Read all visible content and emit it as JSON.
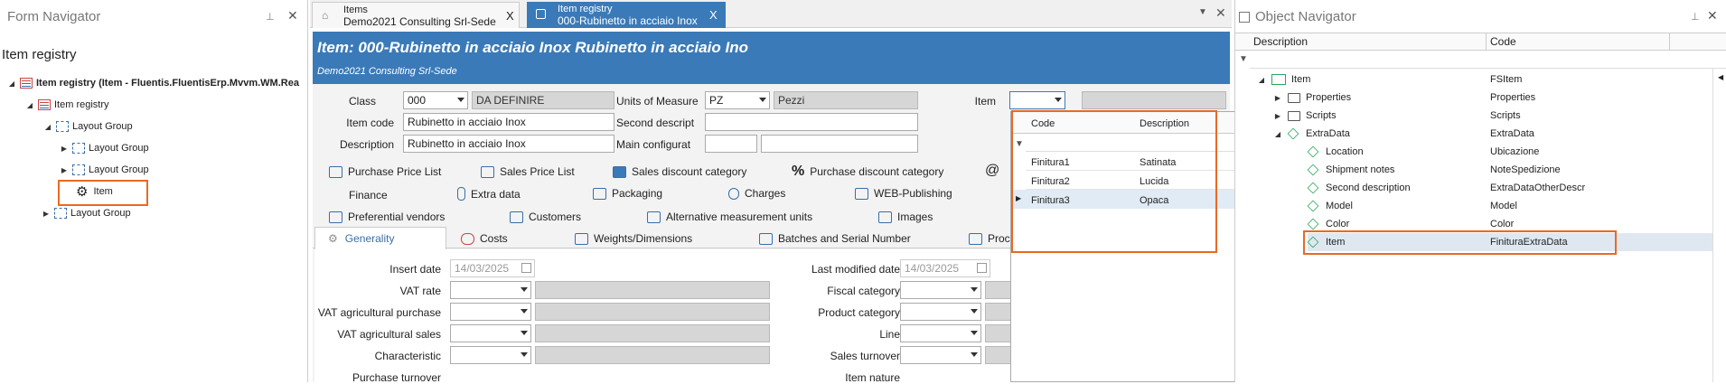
{
  "form_navigator": {
    "title": "Form Navigator",
    "subtitle": "Item registry",
    "tree": [
      {
        "label": "Item registry (Item - Fluentis.FluentisErp.Mvvm.WM.Rea"
      },
      {
        "label": "Item registry"
      },
      {
        "label": "Layout Group"
      },
      {
        "label": "Layout Group"
      },
      {
        "label": "Layout Group"
      },
      {
        "label": "Item"
      },
      {
        "label": "Layout Group"
      }
    ]
  },
  "tabs": [
    {
      "line1": "Items",
      "line2": "Demo2021 Consulting Srl-Sede"
    },
    {
      "line1": "Item registry",
      "line2": "000-Rubinetto in acciaio Inox"
    }
  ],
  "header": {
    "title": "Item: 000-Rubinetto in acciaio Inox Rubinetto in acciaio Ino",
    "subtitle": "Demo2021 Consulting Srl-Sede"
  },
  "form": {
    "class_label": "Class",
    "class_value": "000",
    "class_desc": "DA DEFINIRE",
    "uom_label": "Units of Measure",
    "uom_value": "PZ",
    "uom_desc": "Pezzi",
    "item_label": "Item",
    "item_code_label": "Item code",
    "item_code_value": "Rubinetto in acciaio Inox",
    "second_desc_label": "Second descript",
    "description_label": "Description",
    "description_value": "Rubinetto in acciaio Inox",
    "main_config_label": "Main configurat"
  },
  "toolbar": [
    {
      "label": "Purchase Price List"
    },
    {
      "label": "Sales Price List"
    },
    {
      "label": "Sales discount category"
    },
    {
      "label": "Purchase discount category"
    },
    {
      "label": "Finance"
    },
    {
      "label": "Extra data"
    },
    {
      "label": "Packaging"
    },
    {
      "label": "Charges"
    },
    {
      "label": "WEB-Publishing"
    },
    {
      "label": "Preferential vendors"
    },
    {
      "label": "Customers"
    },
    {
      "label": "Alternative measurement units"
    },
    {
      "label": "Images"
    }
  ],
  "subtabs": [
    {
      "label": "Generality"
    },
    {
      "label": "Costs"
    },
    {
      "label": "Weights/Dimensions"
    },
    {
      "label": "Batches and Serial Number"
    },
    {
      "label": "Proc"
    }
  ],
  "generality": {
    "insert_date_label": "Insert date",
    "insert_date": "14/03/2025",
    "last_modified_label": "Last modified date",
    "last_modified": "14/03/2025",
    "left_labels": [
      "VAT rate",
      "VAT agricultural purchase",
      "VAT agricultural sales",
      "Characteristic",
      "Purchase turnover"
    ],
    "right_labels": [
      "Fiscal category",
      "Product category",
      "Line",
      "Sales turnover",
      "Item nature"
    ]
  },
  "dropdown_grid": {
    "col_code": "Code",
    "col_desc": "Description",
    "rows": [
      {
        "code": "Finitura1",
        "desc": "Satinata"
      },
      {
        "code": "Finitura2",
        "desc": "Lucida"
      },
      {
        "code": "Finitura3",
        "desc": "Opaca"
      }
    ]
  },
  "object_navigator": {
    "title": "Object Navigator",
    "col_desc": "Description",
    "col_code": "Code",
    "rows": [
      {
        "desc": "Item",
        "code": "FSItem"
      },
      {
        "desc": "Properties",
        "code": "Properties"
      },
      {
        "desc": "Scripts",
        "code": "Scripts"
      },
      {
        "desc": "ExtraData",
        "code": "ExtraData"
      },
      {
        "desc": "Location",
        "code": "Ubicazione"
      },
      {
        "desc": "Shipment notes",
        "code": "NoteSpedizione"
      },
      {
        "desc": "Second description",
        "code": "ExtraDataOtherDescr"
      },
      {
        "desc": "Model",
        "code": "Model"
      },
      {
        "desc": "Color",
        "code": "Color"
      },
      {
        "desc": "Item",
        "code": "FinituraExtraData"
      }
    ]
  },
  "colors": {
    "accent": "#3a7ab8",
    "highlight": "#e86a24"
  }
}
